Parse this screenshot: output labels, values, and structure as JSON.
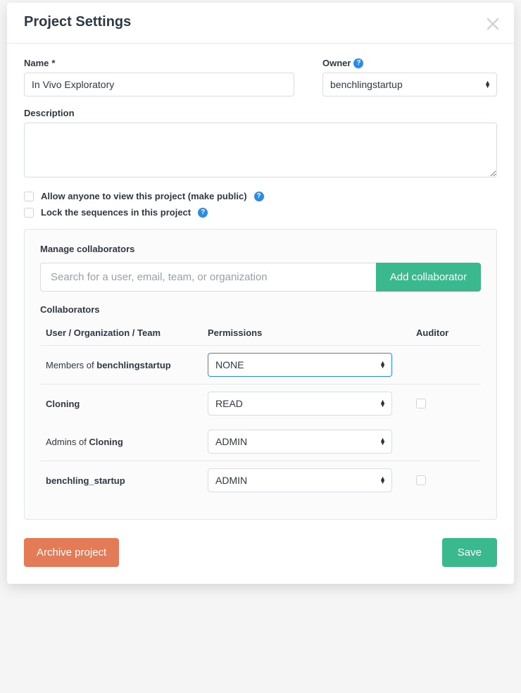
{
  "modal": {
    "title": "Project Settings",
    "close_aria": "Close"
  },
  "form": {
    "name_label": "Name",
    "name_value": "In Vivo Exploratory",
    "owner_label": "Owner",
    "owner_value": "benchlingstartup",
    "description_label": "Description",
    "description_value": "",
    "cb_public_label": "Allow anyone to view this project (make public)",
    "cb_public_checked": false,
    "cb_lock_label": "Lock the sequences in this project",
    "cb_lock_checked": false
  },
  "manage": {
    "title": "Manage collaborators",
    "search_placeholder": "Search for a user, email, team, or organization",
    "add_label": "Add collaborator",
    "subtitle": "Collaborators",
    "col_user": "User / Organization / Team",
    "col_perm": "Permissions",
    "col_aud": "Auditor",
    "rows": [
      {
        "label_prefix": "Members of ",
        "label_bold": "benchlingstartup",
        "perm": "NONE",
        "highlight": true,
        "auditor": null
      },
      {
        "label_prefix": "",
        "label_bold": "Cloning",
        "perm": "READ",
        "highlight": false,
        "auditor": false
      },
      {
        "label_prefix": "Admins of ",
        "label_bold": "Cloning",
        "perm": "ADMIN",
        "highlight": false,
        "auditor": null
      },
      {
        "label_prefix": "",
        "label_bold": "benchling_startup",
        "perm": "ADMIN",
        "highlight": false,
        "auditor": false
      }
    ]
  },
  "footer": {
    "archive_label": "Archive project",
    "save_label": "Save"
  }
}
